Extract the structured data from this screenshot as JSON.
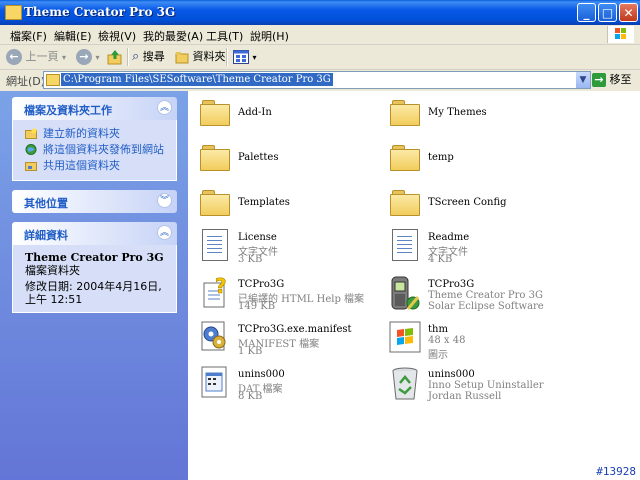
{
  "window": {
    "title": "Theme Creator Pro 3G"
  },
  "menu": [
    "檔案(F)",
    "編輯(E)",
    "檢視(V)",
    "我的最愛(A)",
    "工具(T)",
    "說明(H)"
  ],
  "toolbar": {
    "back": "上一頁",
    "search": "搜尋",
    "folders": "資料夾"
  },
  "address": {
    "label": "網址(D)",
    "path": "C:\\Program Files\\SESoftware\\Theme Creator Pro 3G",
    "go": "移至"
  },
  "sidebar": {
    "tasks": {
      "title": "檔案及資料夾工作",
      "items": [
        "建立新的資料夾",
        "將這個資料夾發佈到網站",
        "共用這個資料夾"
      ]
    },
    "other": {
      "title": "其他位置"
    },
    "details": {
      "title": "詳細資料",
      "name": "Theme Creator Pro 3G",
      "type": "檔案資料夾",
      "modified": "修改日期: 2004年4月16日, 上午 12:51"
    }
  },
  "files": [
    {
      "name": "Add-In",
      "kind": "folder"
    },
    {
      "name": "My Themes",
      "kind": "folder"
    },
    {
      "name": "Palettes",
      "kind": "folder"
    },
    {
      "name": "temp",
      "kind": "folder"
    },
    {
      "name": "Templates",
      "kind": "folder"
    },
    {
      "name": "TScreen Config",
      "kind": "folder"
    },
    {
      "name": "License",
      "line2": "文字文件",
      "line3": "3 KB",
      "kind": "text"
    },
    {
      "name": "Readme",
      "line2": "文字文件",
      "line3": "4 KB",
      "kind": "text"
    },
    {
      "name": "TCPro3G",
      "line2": "已編譯的 HTML Help 檔案",
      "line3": "149 KB",
      "kind": "help"
    },
    {
      "name": "TCPro3G",
      "line2": "Theme Creator Pro 3G",
      "line3": "Solar Eclipse Software",
      "kind": "app"
    },
    {
      "name": "TCPro3G.exe.manifest",
      "line2": "MANIFEST 檔案",
      "line3": "1 KB",
      "kind": "manifest"
    },
    {
      "name": "thm",
      "line2": "48 x 48",
      "line3": "圖示",
      "kind": "icon"
    },
    {
      "name": "unins000",
      "line2": "DAT 檔案",
      "line3": "8 KB",
      "kind": "dat"
    },
    {
      "name": "unins000",
      "line2": "Inno Setup Uninstaller",
      "line3": "Jordan Russell",
      "kind": "uninstaller"
    }
  ],
  "footer": "#13928",
  "colors": {
    "titlebar": "#0858e6",
    "sidebar": "#6f8fe0",
    "link": "#215dc6"
  }
}
